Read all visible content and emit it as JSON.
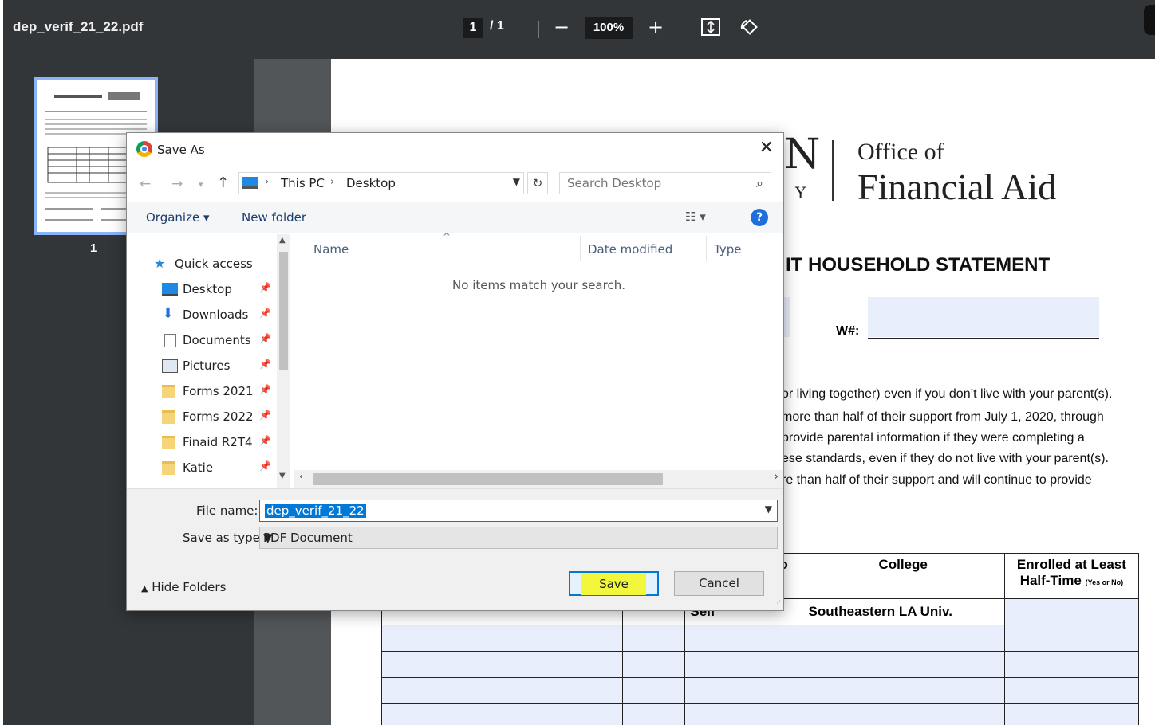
{
  "viewer": {
    "filename": "dep_verif_21_22.pdf",
    "page_current": "1",
    "page_total": "/ 1",
    "zoom": "100%",
    "thumbnail_label": "1"
  },
  "document": {
    "logo_letter": "N",
    "logo_letter2": "Y",
    "office_line1": "Office of",
    "office_line2": "Financial Aid",
    "section_title": "IT HOUSEHOLD STATEMENT",
    "w_label": "W#:",
    "paragraph": [
      "or living together) even if you don’t live with your parent(s).",
      "more than half of their support from July 1, 2020, through",
      "provide parental information if they were completing a",
      "ese standards, even if they do not live with your parent(s).",
      "re than half of their support and will continue to provide"
    ],
    "table": {
      "col_college": "College",
      "col_enrolled": "Enrolled at Least",
      "col_halftime": "Half-Time",
      "col_yesno": "(Yes or No)",
      "col_partial": "o",
      "row1_self": "Self",
      "row1_college": "Southeastern LA Univ."
    }
  },
  "dialog": {
    "title": "Save As",
    "address": {
      "pc": "This PC",
      "folder": "Desktop"
    },
    "search_placeholder": "Search Desktop",
    "toolbar": {
      "organize": "Organize ▾",
      "new_folder": "New folder"
    },
    "nav": [
      {
        "label": "Quick access"
      },
      {
        "label": "Desktop"
      },
      {
        "label": "Downloads"
      },
      {
        "label": "Documents"
      },
      {
        "label": "Pictures"
      },
      {
        "label": "Forms 2021"
      },
      {
        "label": "Forms 2022"
      },
      {
        "label": "Finaid R2T4"
      },
      {
        "label": "Katie"
      }
    ],
    "columns": {
      "name": "Name",
      "date": "Date modified",
      "type": "Type"
    },
    "empty_message": "No items match your search.",
    "file_name_label": "File name:",
    "file_name_value": "dep_verif_21_22",
    "save_type_label": "Save as type:",
    "save_type_value": "PDF Document",
    "hide_folders": "Hide Folders",
    "save_label": "Save",
    "cancel_label": "Cancel"
  }
}
